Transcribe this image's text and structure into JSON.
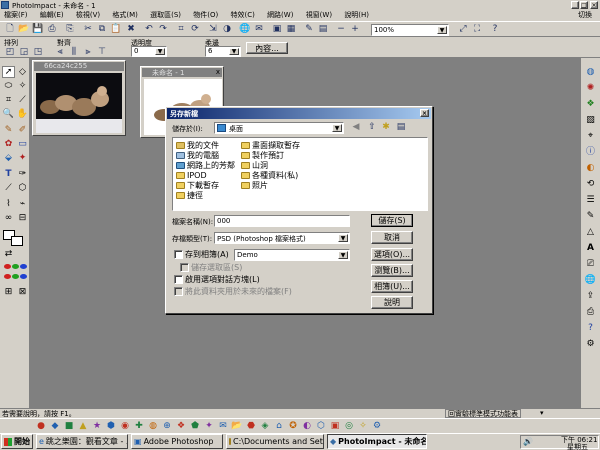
{
  "app": {
    "title": "PhotoImpact - 未命名 - 1",
    "switch_label": "切換"
  },
  "menu": {
    "items": [
      "檔案(F)",
      "編輯(E)",
      "檢視(V)",
      "格式(M)",
      "選取區(S)",
      "物件(O)",
      "特效(C)",
      "網路(W)",
      "視窗(W)",
      "說明(H)"
    ]
  },
  "toolbar": {
    "zoom_value": "100%"
  },
  "attribute_bar": {
    "arrange_label": "排列",
    "align_label": "對齊",
    "opacity_label": "透明度",
    "opacity_value": "0",
    "feather_label": "柔邊",
    "feather_value": "6",
    "content_button": "內容..."
  },
  "documents": [
    {
      "title": "66ca24c255"
    },
    {
      "title": "未命名 - 1"
    }
  ],
  "dialog": {
    "title": "另存新檔",
    "save_in_label": "儲存於(I):",
    "save_in_value": "桌面",
    "files": [
      {
        "name": "我的文件",
        "icon": "my-documents-icon"
      },
      {
        "name": "我的電腦",
        "icon": "my-computer-icon"
      },
      {
        "name": "網路上的芳鄰",
        "icon": "network-places-icon"
      },
      {
        "name": "IPOD",
        "icon": "folder-icon"
      },
      {
        "name": "下載暫存",
        "icon": "folder-icon"
      },
      {
        "name": "捷徑",
        "icon": "folder-icon"
      },
      {
        "name": "畫面擷取暫存",
        "icon": "folder-icon"
      },
      {
        "name": "製作預訂",
        "icon": "folder-icon"
      },
      {
        "name": "山洞",
        "icon": "folder-icon"
      },
      {
        "name": "各種資料(私)",
        "icon": "folder-icon"
      },
      {
        "name": "照片",
        "icon": "folder-icon"
      }
    ],
    "filename_label": "檔案名稱(N):",
    "filename_value": "000",
    "filetype_label": "存檔類型(T):",
    "filetype_value": "PSD (Photoshop 檔案格式)",
    "save_to_album_label": "存到相簿(A)",
    "album_value": "Demo",
    "save_selection_label": "儲存選取區(S)",
    "use_dialog_label": "啟用選項對話方塊(L)",
    "merge_label": "將此資料夾用於未來的檔案(F)",
    "save_button": "儲存(S)",
    "cancel_button": "取消",
    "options_button": "選項(O)...",
    "browse_button": "瀏覽(B)...",
    "album_button": "相簿(U)...",
    "help_button": "說明"
  },
  "status": {
    "help_text": "若需要說明，請按 F1。",
    "mode_text": "回實驗標準模式功能表"
  },
  "taskbar": {
    "start_label": "開始",
    "tasks": [
      "跳之樂園：觀看文章 - ...",
      "Adobe Photoshop",
      "C:\\Documents and Setting...",
      "PhotoImpact - 未命名 - 1"
    ],
    "time": "下午 06:21",
    "day": "星期五"
  }
}
